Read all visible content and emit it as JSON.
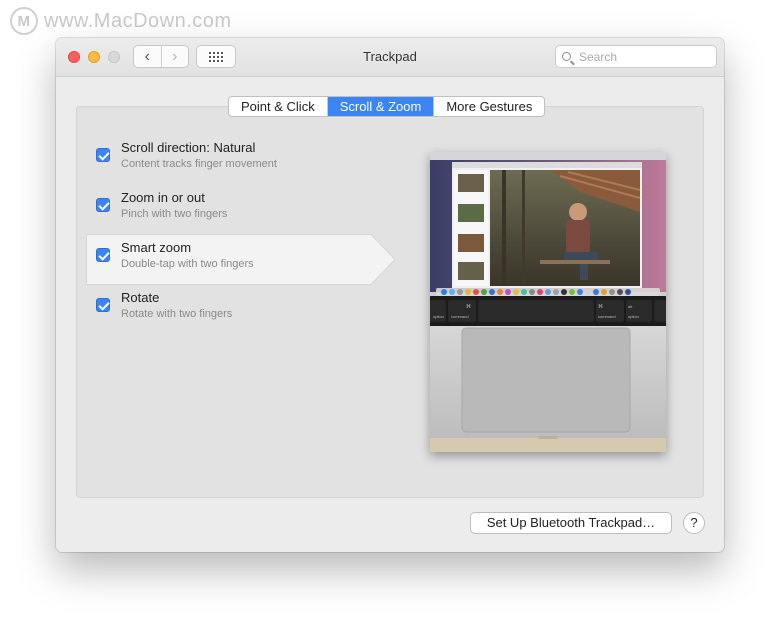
{
  "watermark": {
    "logo_letter": "M",
    "text": "www.MacDown.com"
  },
  "window": {
    "title": "Trackpad",
    "search_placeholder": "Search",
    "nav": {
      "back_glyph": "‹",
      "forward_glyph": "›"
    }
  },
  "tabs": [
    {
      "label": "Point & Click",
      "active": false
    },
    {
      "label": "Scroll & Zoom",
      "active": true
    },
    {
      "label": "More Gestures",
      "active": false
    }
  ],
  "options": [
    {
      "title": "Scroll direction: Natural",
      "subtitle": "Content tracks finger movement",
      "checked": true
    },
    {
      "title": "Zoom in or out",
      "subtitle": "Pinch with two fingers",
      "checked": true
    },
    {
      "title": "Smart zoom",
      "subtitle": "Double-tap with two fingers",
      "checked": true,
      "selected": true
    },
    {
      "title": "Rotate",
      "subtitle": "Rotate with two fingers",
      "checked": true
    }
  ],
  "preview": {
    "keys": [
      "option",
      "command",
      "command",
      "option"
    ],
    "key_symbols": [
      "⌘",
      "⌘",
      "alt"
    ]
  },
  "footer": {
    "setup_button": "Set Up Bluetooth Trackpad…",
    "help_button": "?"
  },
  "colors": {
    "accent": "#3b84f3",
    "close": "#fc605c",
    "minimize": "#fdbc40",
    "maximize_disabled": "#d8d8d8"
  }
}
